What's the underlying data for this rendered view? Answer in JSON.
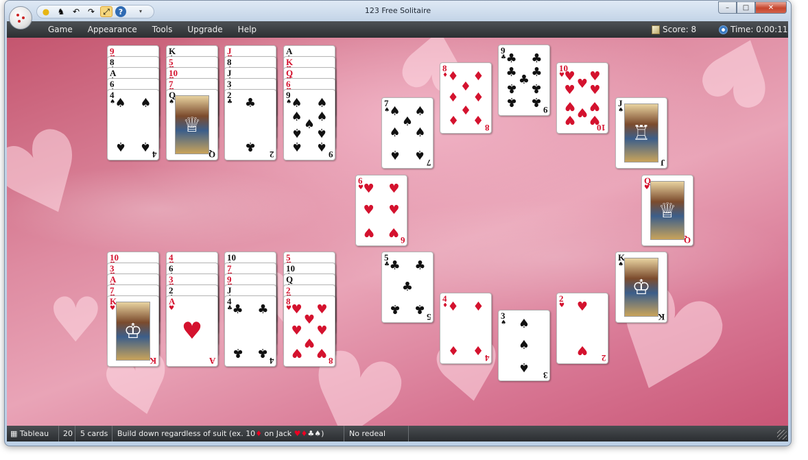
{
  "window": {
    "title": "123 Free Solitaire",
    "minimize": "–",
    "maximize": "□",
    "close": "✕"
  },
  "quick_access": [
    {
      "icon": "new-game-icon",
      "glyph": "●"
    },
    {
      "icon": "hint-icon",
      "glyph": "♞"
    },
    {
      "icon": "undo-icon",
      "glyph": "↶"
    },
    {
      "icon": "redo-icon",
      "glyph": "↷"
    },
    {
      "icon": "autoplay-icon",
      "glyph": "⤢"
    },
    {
      "icon": "help-icon",
      "glyph": "?"
    }
  ],
  "menu": [
    "Game",
    "Appearance",
    "Tools",
    "Upgrade",
    "Help"
  ],
  "score": {
    "label": "Score: 8"
  },
  "time": {
    "label": "Time: 0:00:11"
  },
  "status": {
    "game": "Tableau",
    "count": "20",
    "cards": "5 cards",
    "rule_prefix": "Build down regardless of suit (ex. 10",
    "rule_mid": " on Jack ",
    "rule_suffix": ")",
    "redeal": "No redeal"
  },
  "colors": {
    "red": "#d4122e",
    "black": "#111111",
    "felt": "#de8ba1"
  },
  "piles": [
    {
      "name": "pile-1",
      "cards": [
        [
          "9",
          "♥"
        ],
        [
          "8",
          "♠"
        ],
        [
          "A",
          "♠"
        ],
        [
          "6",
          "♠"
        ],
        [
          "4",
          "♠"
        ]
      ]
    },
    {
      "name": "pile-2",
      "cards": [
        [
          "K",
          "♠"
        ],
        [
          "5",
          "♥"
        ],
        [
          "10",
          "♥"
        ],
        [
          "7",
          "♥"
        ],
        [
          "Q",
          "♠"
        ]
      ]
    },
    {
      "name": "pile-3",
      "cards": [
        [
          "J",
          "♥"
        ],
        [
          "8",
          "♠"
        ],
        [
          "J",
          "♠"
        ],
        [
          "3",
          "♠"
        ],
        [
          "2",
          "♣"
        ]
      ]
    },
    {
      "name": "pile-4",
      "cards": [
        [
          "A",
          "♠"
        ],
        [
          "K",
          "♥"
        ],
        [
          "Q",
          "♥"
        ],
        [
          "6",
          "♥"
        ],
        [
          "9",
          "♠"
        ]
      ]
    },
    {
      "name": "pile-5",
      "cards": [
        [
          "10",
          "♥"
        ],
        [
          "3",
          "♥"
        ],
        [
          "A",
          "♥"
        ],
        [
          "7",
          "♥"
        ],
        [
          "K",
          "♥"
        ]
      ]
    },
    {
      "name": "pile-6",
      "cards": [
        [
          "4",
          "♥"
        ],
        [
          "6",
          "♠"
        ],
        [
          "3",
          "♥"
        ],
        [
          "2",
          "♠"
        ],
        [
          "A",
          "♥"
        ]
      ]
    },
    {
      "name": "pile-7",
      "cards": [
        [
          "10",
          "♠"
        ],
        [
          "7",
          "♥"
        ],
        [
          "9",
          "♥"
        ],
        [
          "J",
          "♠"
        ],
        [
          "4",
          "♣"
        ]
      ]
    },
    {
      "name": "pile-8",
      "cards": [
        [
          "5",
          "♥"
        ],
        [
          "10",
          "♠"
        ],
        [
          "Q",
          "♠"
        ],
        [
          "2",
          "♥"
        ],
        [
          "8",
          "♥"
        ]
      ]
    }
  ],
  "ring": [
    {
      "rank": "8",
      "suit": "♦"
    },
    {
      "rank": "9",
      "suit": "♣"
    },
    {
      "rank": "10",
      "suit": "♥"
    },
    {
      "rank": "J",
      "suit": "♠"
    },
    {
      "rank": "Q",
      "suit": "♥"
    },
    {
      "rank": "K",
      "suit": "♠"
    },
    {
      "rank": "2",
      "suit": "♥"
    },
    {
      "rank": "3",
      "suit": "♠"
    },
    {
      "rank": "4",
      "suit": "♦"
    },
    {
      "rank": "5",
      "suit": "♣"
    },
    {
      "rank": "6",
      "suit": "♥"
    },
    {
      "rank": "7",
      "suit": "♠"
    }
  ]
}
